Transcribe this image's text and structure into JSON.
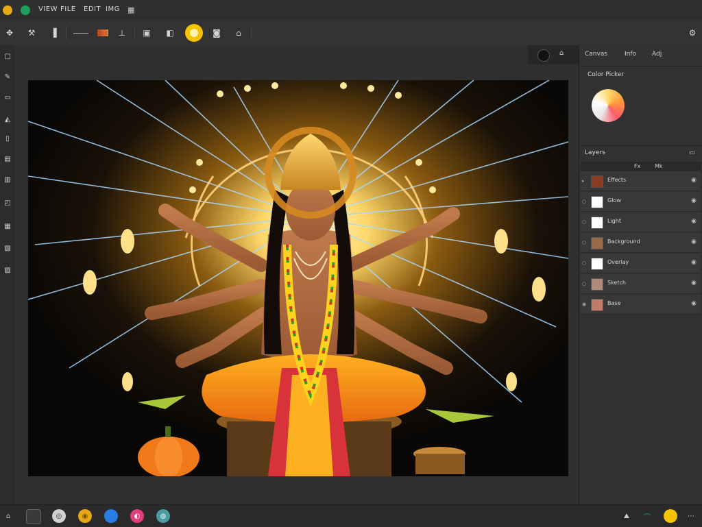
{
  "titlebar": {
    "menu": [
      "VIEW",
      "FILE",
      "EDIT",
      "IMG"
    ]
  },
  "toolbar": {
    "tools": [
      "move-icon",
      "brush-icon",
      "line-icon",
      "texture-icon",
      "pen-icon",
      "crop-icon",
      "layers-icon",
      "sun-icon",
      "shape-icon",
      "stamp-icon"
    ],
    "accent": "#f5c400"
  },
  "canvas_header": {
    "tabs": [
      "Canvas",
      "Info",
      "Adj"
    ]
  },
  "color_panel": {
    "title": "Color Picker"
  },
  "layers_panel": {
    "title": "Layers",
    "subtabs": [
      "Fx",
      "Mk"
    ],
    "layers": [
      {
        "name": "Effects",
        "thumb": "#8a3b22"
      },
      {
        "name": "Glow",
        "thumb": "#ffffff"
      },
      {
        "name": "Light",
        "thumb": "#ffffff"
      },
      {
        "name": "Background",
        "thumb": "#9a6a4a"
      },
      {
        "name": "Overlay",
        "thumb": "#ffffff"
      },
      {
        "name": "Sketch",
        "thumb": "#b08a7a"
      },
      {
        "name": "Base",
        "thumb": "#c07a6a"
      }
    ]
  },
  "statusbar": {
    "buttons": [
      {
        "icon": "circle-icon",
        "color": "#3a3a3a"
      },
      {
        "icon": "globe-icon",
        "color": "#d0d0d0"
      },
      {
        "icon": "coin-icon",
        "color": "#e6a817"
      },
      {
        "icon": "blue-dot-icon",
        "color": "#2a7de1"
      },
      {
        "icon": "pink-dot-icon",
        "color": "#e0407a"
      },
      {
        "icon": "camera-icon",
        "color": "#4a9aa0"
      }
    ],
    "right_accent": "#f5c400"
  }
}
